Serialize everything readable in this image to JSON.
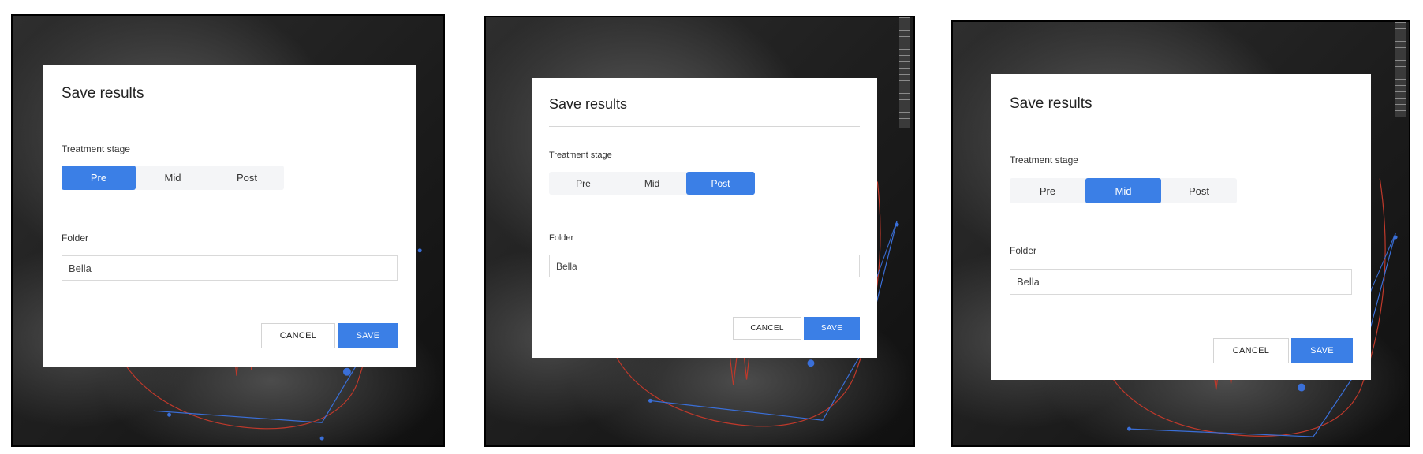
{
  "dialogs": [
    {
      "title": "Save results",
      "stage_label": "Treatment stage",
      "stages": [
        "Pre",
        "Mid",
        "Post"
      ],
      "selected_stage": "Pre",
      "folder_label": "Folder",
      "folder_value": "Bella",
      "cancel_label": "CANCEL",
      "save_label": "SAVE"
    },
    {
      "title": "Save results",
      "stage_label": "Treatment stage",
      "stages": [
        "Pre",
        "Mid",
        "Post"
      ],
      "selected_stage": "Post",
      "folder_label": "Folder",
      "folder_value": "Bella",
      "cancel_label": "CANCEL",
      "save_label": "SAVE"
    },
    {
      "title": "Save results",
      "stage_label": "Treatment stage",
      "stages": [
        "Pre",
        "Mid",
        "Post"
      ],
      "selected_stage": "Mid",
      "folder_label": "Folder",
      "folder_value": "Bella",
      "cancel_label": "CANCEL",
      "save_label": "SAVE"
    }
  ],
  "colors": {
    "accent": "#3b7fe6",
    "tracing_red": "#c0392b",
    "tracing_blue": "#3a6fd8",
    "panel_border": "#000000"
  }
}
